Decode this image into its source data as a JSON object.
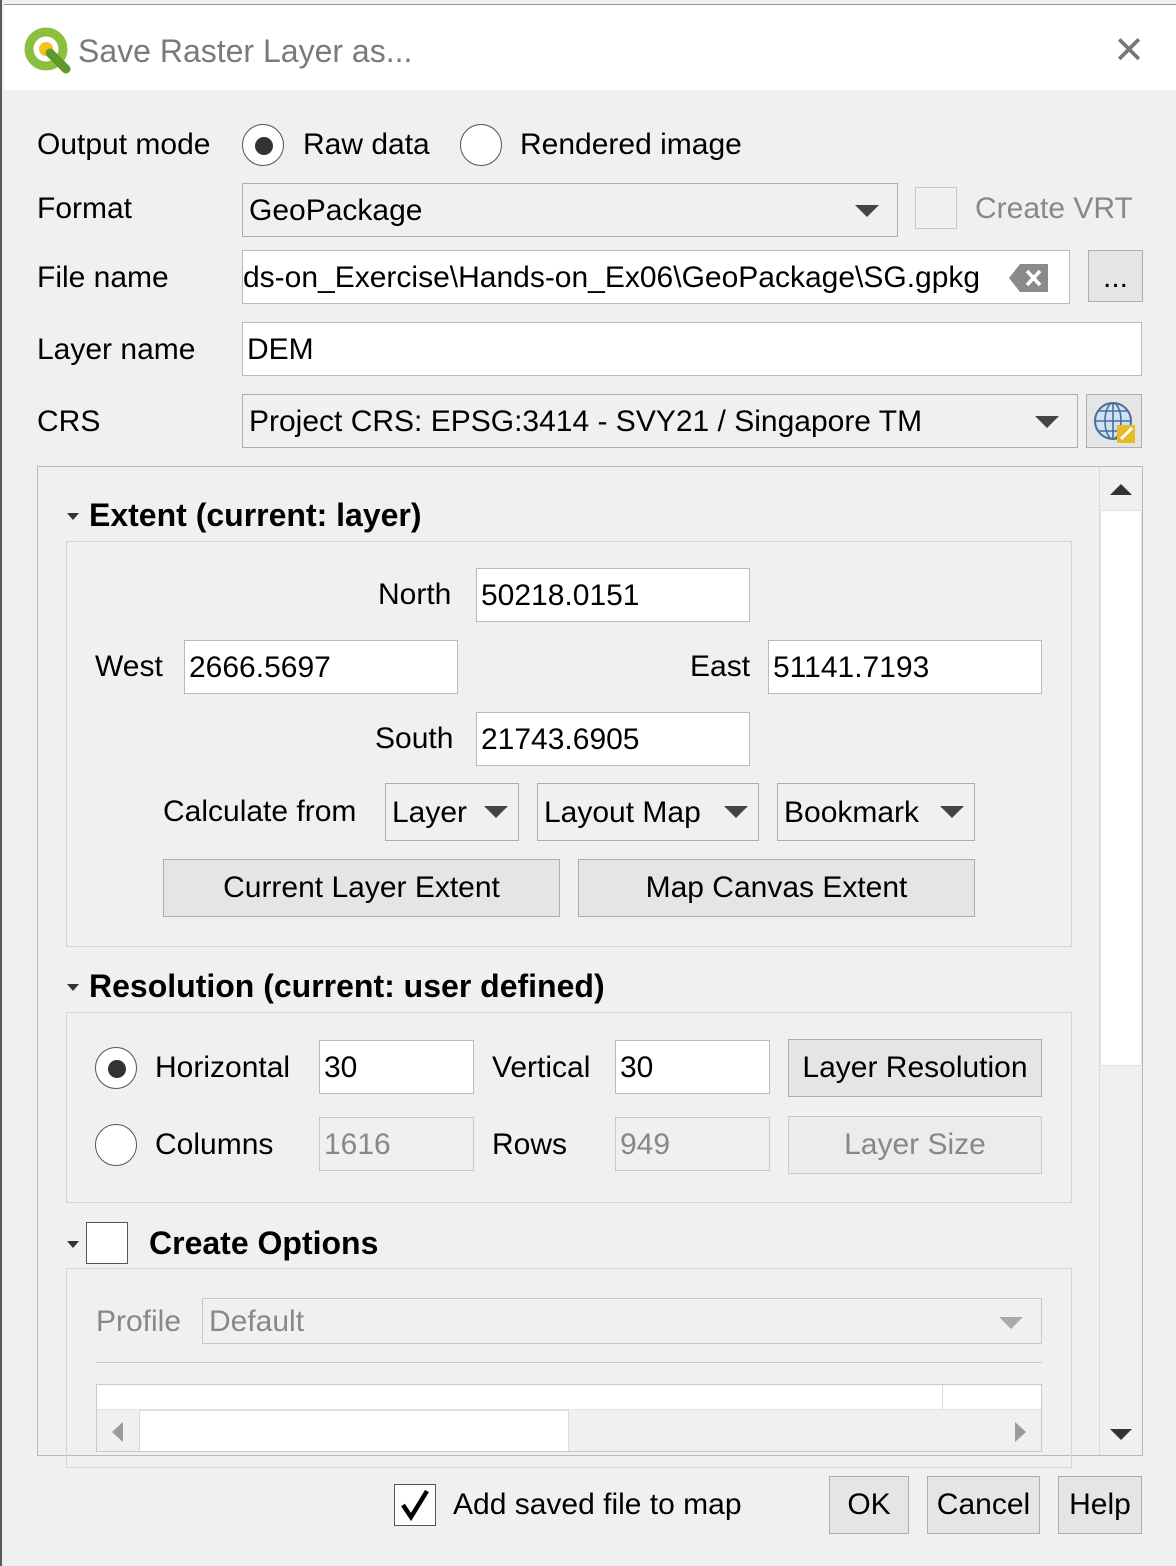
{
  "window": {
    "title": "Save Raster Layer as...",
    "close_label": "✕"
  },
  "output_mode": {
    "label": "Output mode",
    "options": [
      {
        "label": "Raw data",
        "checked": true
      },
      {
        "label": "Rendered image",
        "checked": false
      }
    ]
  },
  "format": {
    "label": "Format",
    "value": "GeoPackage",
    "create_vrt_label": "Create VRT",
    "create_vrt_checked": false
  },
  "file_name": {
    "label": "File name",
    "value": "ds-on_Exercise\\Hands-on_Ex06\\GeoPackage\\SG.gpkg",
    "browse_label": "..."
  },
  "layer_name": {
    "label": "Layer name",
    "value": "DEM"
  },
  "crs": {
    "label": "CRS",
    "value": "Project CRS: EPSG:3414 - SVY21 / Singapore TM"
  },
  "extent": {
    "title": "Extent (current: layer)",
    "north_label": "North",
    "north": "50218.0151",
    "west_label": "West",
    "west": "2666.5697",
    "east_label": "East",
    "east": "51141.7193",
    "south_label": "South",
    "south": "21743.6905",
    "calculate_from_label": "Calculate from",
    "calc_layer": "Layer",
    "calc_layout_map": "Layout Map",
    "calc_bookmark": "Bookmark",
    "current_layer_extent": "Current Layer Extent",
    "map_canvas_extent": "Map Canvas Extent"
  },
  "resolution": {
    "title": "Resolution (current: user defined)",
    "horizontal_label": "Horizontal",
    "horizontal": "30",
    "vertical_label": "Vertical",
    "vertical": "30",
    "layer_resolution": "Layer Resolution",
    "columns_label": "Columns",
    "columns": "1616",
    "rows_label": "Rows",
    "rows": "949",
    "layer_size": "Layer Size",
    "mode": "horizontal"
  },
  "create_options": {
    "title": "Create Options",
    "checked": false,
    "profile_label": "Profile",
    "profile_value": "Default"
  },
  "footer": {
    "add_to_map_label": "Add saved file to map",
    "add_to_map_checked": true,
    "ok": "OK",
    "cancel": "Cancel",
    "help": "Help"
  }
}
